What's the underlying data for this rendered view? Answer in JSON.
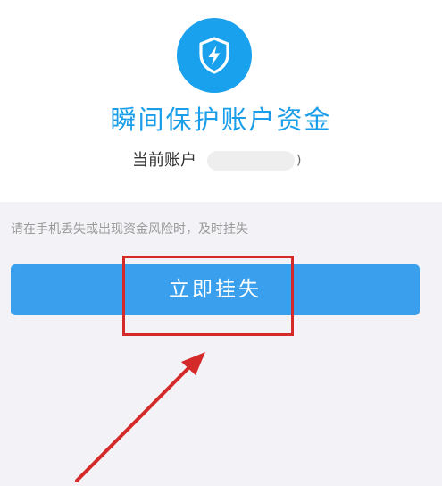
{
  "header": {
    "icon": "shield-lightning-icon",
    "title": "瞬间保护账户资金",
    "account_label": "当前账户",
    "account_suffix": ")"
  },
  "hint": "请在手机丢失或出现资金风险时，及时挂失",
  "action": {
    "button_label": "立即挂失"
  },
  "colors": {
    "brand": "#1aa1ee",
    "button": "#3aa0ed",
    "annotation": "#d42a2a",
    "background": "#f3f3f7"
  }
}
